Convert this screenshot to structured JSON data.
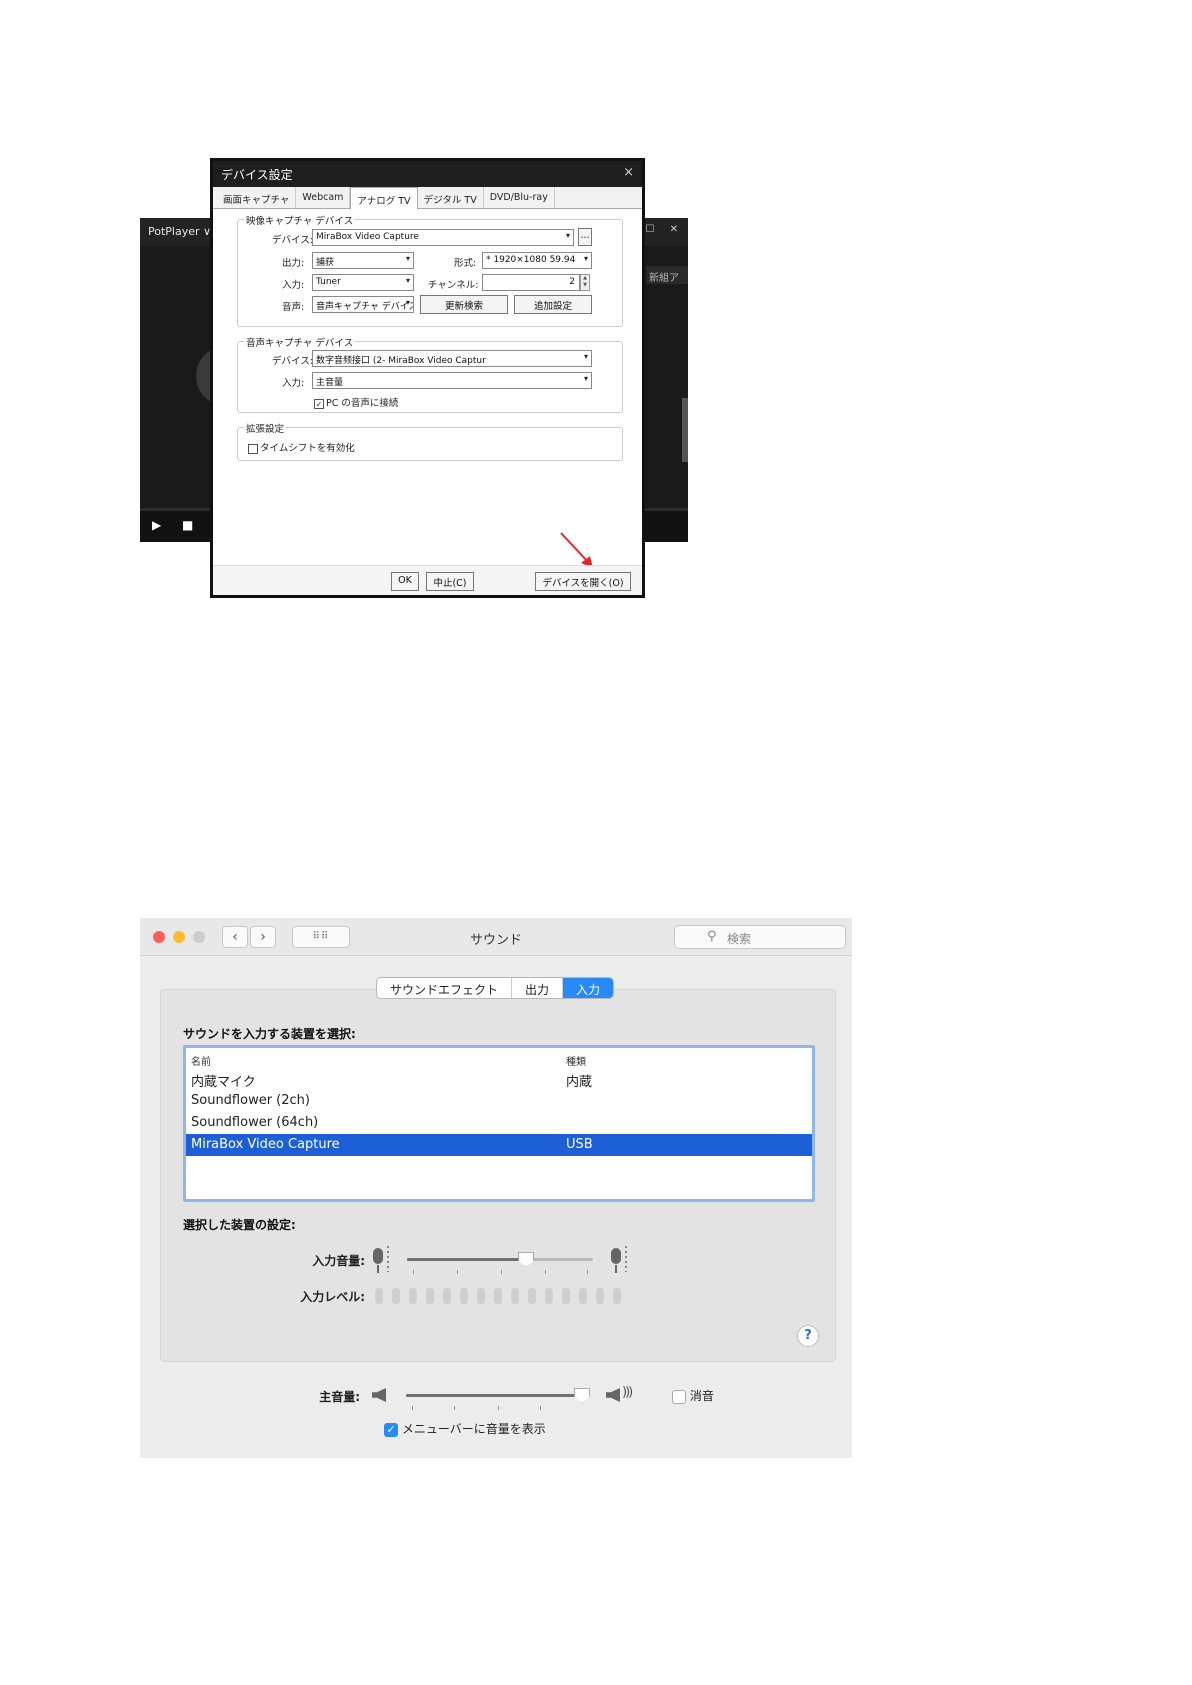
{
  "potplayer": {
    "title": "PotPlayer ∨",
    "window_buttons": "‐ ☐ ✕",
    "right_label": "新組ア",
    "controls": {
      "play": "▶",
      "stop": "■"
    }
  },
  "device_dialog": {
    "title": "デバイス設定",
    "close": "×",
    "tabs": [
      "画面キャプチャ",
      "Webcam",
      "アナログ TV",
      "デジタル TV",
      "DVD/Blu-ray"
    ],
    "active_tab": 2,
    "video_group": {
      "label": "映像キャプチャ デバイス",
      "device_label": "デバイス:",
      "device_value": "MiraBox Video Capture",
      "browse_label": "...",
      "output_label": "出力:",
      "output_value": "捕获",
      "format_label": "形式:",
      "format_value": "* 1920×1080 59.94",
      "input_label": "入力:",
      "input_value": "Tuner",
      "channel_label": "チャンネル:",
      "channel_value": "2",
      "audio_label": "音声:",
      "audio_value": "音声キャプチャ デバイスを使",
      "refresh_button": "更新検索",
      "advanced_button": "追加設定"
    },
    "audio_group": {
      "label": "音声キャプチャ デバイス",
      "device_label": "デバイス:",
      "device_value": "数字音频接口 (2- MiraBox Video Captur",
      "input_label": "入力:",
      "input_value": "主音量",
      "pc_audio_label": "PC の音声に接続",
      "pc_audio_checked": true
    },
    "ext_group": {
      "label": "拡張設定",
      "timeshift_label": "タイムシフトを有効化",
      "timeshift_checked": false
    },
    "footer": {
      "ok": "OK",
      "cancel": "中止(C)",
      "open_device": "デバイスを開く(O)"
    },
    "arrow_color": "#e8262a"
  },
  "sound_prefs": {
    "title": "サウンド",
    "search_placeholder": "検索",
    "nav_back": "‹",
    "nav_forward": "›",
    "grid_icon": "⠿⠿",
    "tabs": [
      "サウンドエフェクト",
      "出力",
      "入力"
    ],
    "active_tab": 2,
    "select_heading": "サウンドを入力する装置を選択:",
    "columns": {
      "name": "名前",
      "type": "種類"
    },
    "devices": [
      {
        "name": "内蔵マイク",
        "type": "内蔵"
      },
      {
        "name": "Soundflower (2ch)",
        "type": ""
      },
      {
        "name": "Soundflower (64ch)",
        "type": ""
      },
      {
        "name": "MiraBox Video Capture",
        "type": "USB"
      }
    ],
    "selected_device": 3,
    "settings_heading": "選択した装置の設定:",
    "input_volume_label": "入力音量:",
    "input_volume": 0.64,
    "input_level_label": "入力レベル:",
    "input_level_segments": 15,
    "help": "?",
    "master_volume_label": "主音量:",
    "master_volume": 1.0,
    "mute_label": "消音",
    "mute_checked": false,
    "menubar_label": "メニューバーに音量を表示",
    "menubar_checked": true,
    "accent_color": "#2a8af5",
    "selection_color": "#1d5fd4"
  }
}
